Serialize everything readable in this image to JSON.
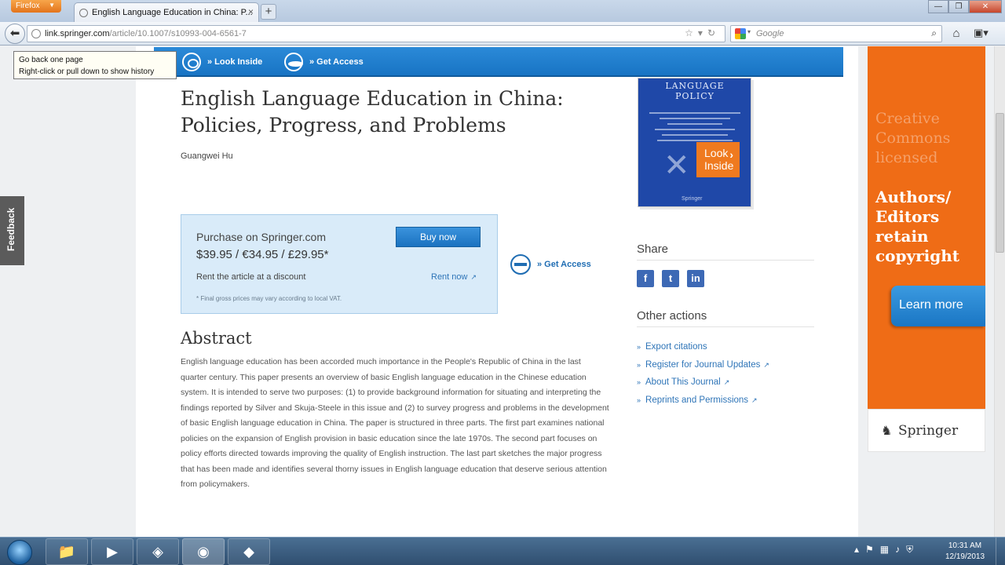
{
  "browser": {
    "menu_label": "Firefox",
    "tab_title": "English Language Education in China: P...",
    "url_domain": "link.springer.com",
    "url_path": "/article/10.1007/s10993-004-6561-7",
    "search_placeholder": "Google",
    "tooltip_line1": "Go back one page",
    "tooltip_line2": "Right-click or pull down to show history"
  },
  "topbar": {
    "look_inside": "» Look Inside",
    "get_access": "» Get Access"
  },
  "feedback_label": "Feedback",
  "article": {
    "title_line1": "English Language Education in China:",
    "title_line2": "Policies, Progress, and Problems",
    "author": "Guangwei Hu"
  },
  "purchase": {
    "heading": "Purchase on Springer.com",
    "price": "$39.95 / €34.95 / £29.95*",
    "buy_label": "Buy now",
    "rent_text": "Rent the article at a discount",
    "rent_link": "Rent now",
    "note": "* Final gross prices may vary according to local VAT."
  },
  "get_access_2": "» Get Access",
  "abstract": {
    "heading": "Abstract",
    "text": "English language education has been accorded much importance in the People's Republic of China in the last quarter century. This paper presents an overview of basic English language education in the Chinese education system. It is intended to serve two purposes: (1) to provide background information for situating and interpreting the findings reported by Silver and Skuja-Steele in this issue and (2) to survey progress and problems in the development of basic English language education in China. The paper is structured in three parts. The first part examines national policies on the expansion of English provision in basic education since the late 1970s. The second part focuses on policy efforts directed towards improving the quality of English instruction. The last part sketches the major progress that has been made and identifies several thorny issues in English language education that deserve serious attention from policymakers."
  },
  "cover": {
    "title_line1": "LANGUAGE",
    "title_line2": "POLICY",
    "publisher": "Springer",
    "look_inside_line1": "Look",
    "look_inside_line2": "Inside"
  },
  "share": {
    "heading": "Share",
    "facebook_glyph": "f",
    "twitter_glyph": "t",
    "linkedin_glyph": "in"
  },
  "other_actions": {
    "heading": "Other actions",
    "items": [
      "Export citations",
      "Register for Journal Updates",
      "About This Journal",
      "Reprints and Permissions"
    ]
  },
  "ad": {
    "cc_line1": "Creative",
    "cc_line2": "Commons",
    "cc_line3": "licensed",
    "main_line1": "Authors/",
    "main_line2": "Editors retain",
    "main_line3": "copyright",
    "button": "Learn more",
    "logo": "Springer"
  },
  "taskbar": {
    "time": "10:31 AM",
    "date": "12/19/2013"
  },
  "colors": {
    "springer_blue": "#1a76c4",
    "ad_orange": "#ef6c16",
    "look_inside_orange": "#ef7a1f"
  }
}
